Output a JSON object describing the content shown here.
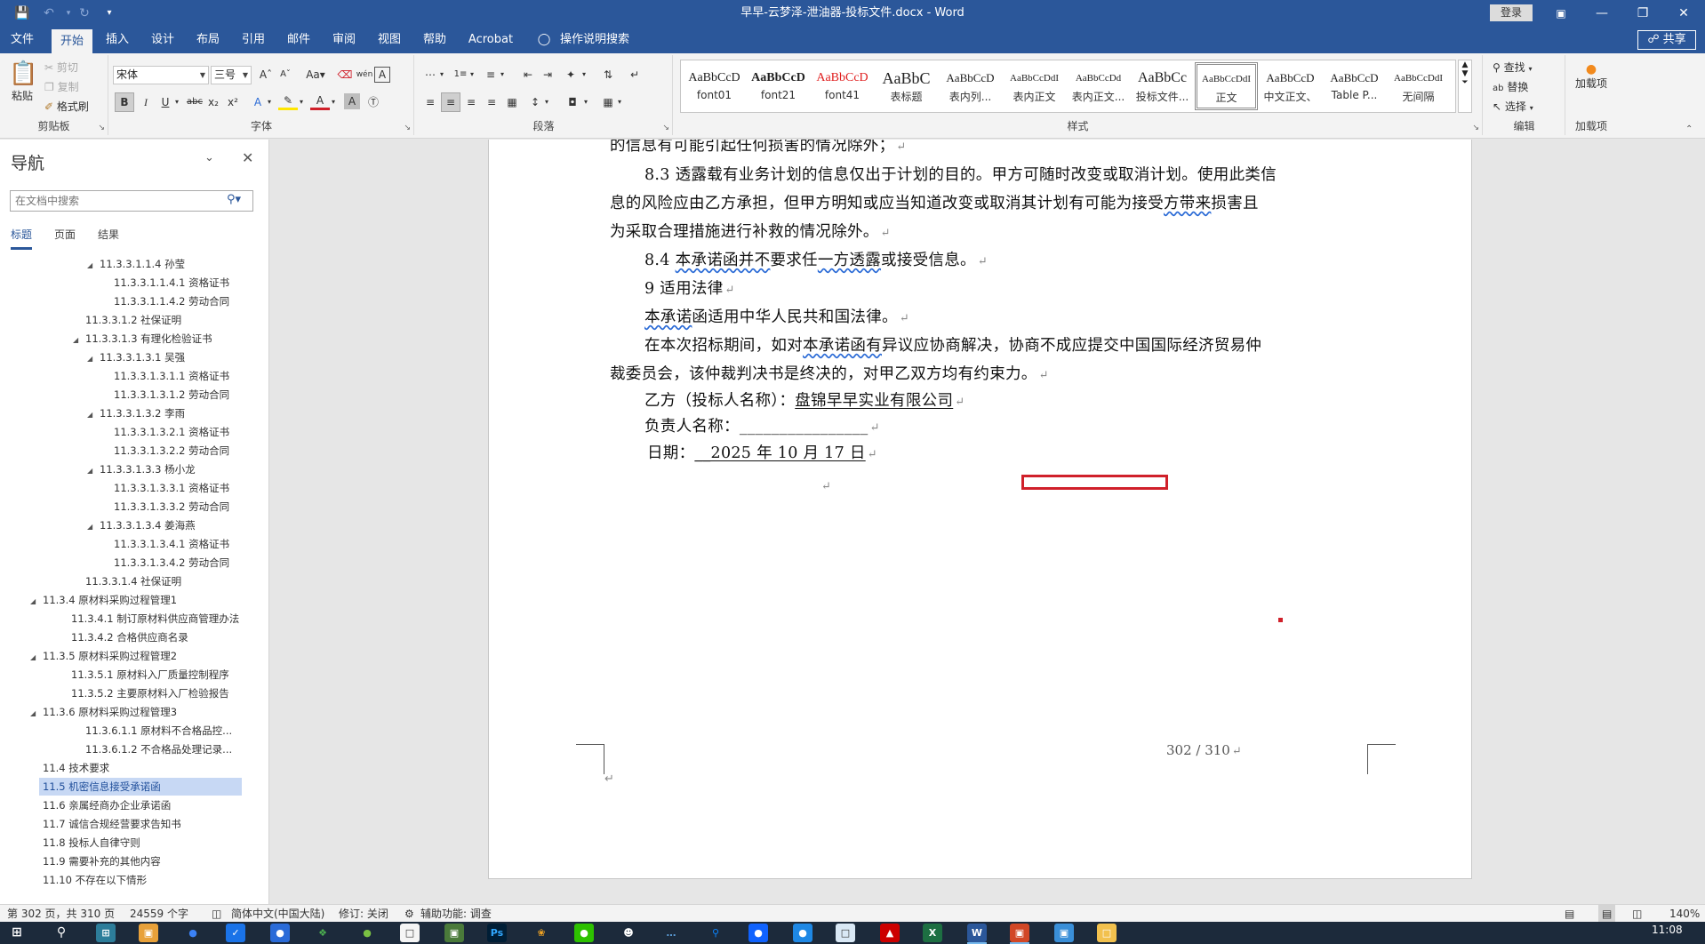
{
  "window": {
    "title": "早早-云梦泽-泄油器-投标文件.docx  -  Word",
    "login_label": "登录",
    "share_label": "共享"
  },
  "tabs": [
    "文件",
    "开始",
    "插入",
    "设计",
    "布局",
    "引用",
    "邮件",
    "审阅",
    "视图",
    "帮助",
    "Acrobat"
  ],
  "tell_me": "操作说明搜索",
  "ribbon": {
    "clipboard": {
      "label": "剪贴板",
      "paste": "粘贴",
      "cut": "剪切",
      "copy": "复制",
      "format_painter": "格式刷"
    },
    "font": {
      "label": "字体",
      "font_name": "宋体",
      "font_size": "三号"
    },
    "paragraph": {
      "label": "段落"
    },
    "styles": {
      "label": "样式",
      "items": [
        {
          "sample": "AaBbCcD",
          "name": "font01"
        },
        {
          "sample": "AaBbCcD",
          "name": "font21"
        },
        {
          "sample": "AaBbCcD",
          "name": "font41"
        },
        {
          "sample": "AaBbC",
          "name": "表标题"
        },
        {
          "sample": "AaBbCcD",
          "name": "表内列..."
        },
        {
          "sample": "AaBbCcDdI",
          "name": "表内正文"
        },
        {
          "sample": "AaBbCcDd",
          "name": "表内正文..."
        },
        {
          "sample": "AaBbCc",
          "name": "投标文件..."
        },
        {
          "sample": "AaBbCcDdI",
          "name": "正文"
        },
        {
          "sample": "AaBbCcD",
          "name": "中文正文、"
        },
        {
          "sample": "AaBbCcD",
          "name": "Table P..."
        },
        {
          "sample": "AaBbCcDdI",
          "name": "无间隔"
        }
      ]
    },
    "editing": {
      "label": "编辑",
      "find": "查找",
      "replace": "替换",
      "select": "选择"
    },
    "addins": {
      "label": "加载项",
      "button": "加载项"
    }
  },
  "nav": {
    "title": "导航",
    "search_placeholder": "在文档中搜索",
    "tabs": [
      "标题",
      "页面",
      "结果"
    ],
    "items": [
      {
        "text": "11.3.3.1.1.4 孙莹",
        "level": 4,
        "expanded": true
      },
      {
        "text": "11.3.3.1.1.4.1 资格证书",
        "level": 5
      },
      {
        "text": "11.3.3.1.1.4.2 劳动合同",
        "level": 5
      },
      {
        "text": "11.3.3.1.2 社保证明",
        "level": 3
      },
      {
        "text": "11.3.3.1.3 有理化检验证书",
        "level": 3,
        "expanded": true
      },
      {
        "text": "11.3.3.1.3.1 吴强",
        "level": 4,
        "expanded": true
      },
      {
        "text": "11.3.3.1.3.1.1 资格证书",
        "level": 5
      },
      {
        "text": "11.3.3.1.3.1.2 劳动合同",
        "level": 5
      },
      {
        "text": "11.3.3.1.3.2 李雨",
        "level": 4,
        "expanded": true
      },
      {
        "text": "11.3.3.1.3.2.1 资格证书",
        "level": 5
      },
      {
        "text": "11.3.3.1.3.2.2 劳动合同",
        "level": 5
      },
      {
        "text": "11.3.3.1.3.3 杨小龙",
        "level": 4,
        "expanded": true
      },
      {
        "text": "11.3.3.1.3.3.1 资格证书",
        "level": 5
      },
      {
        "text": "11.3.3.1.3.3.2 劳动合同",
        "level": 5
      },
      {
        "text": "11.3.3.1.3.4 姜海燕",
        "level": 4,
        "expanded": true
      },
      {
        "text": "11.3.3.1.3.4.1 资格证书",
        "level": 5
      },
      {
        "text": "11.3.3.1.3.4.2 劳动合同",
        "level": 5
      },
      {
        "text": "11.3.3.1.4 社保证明",
        "level": 3
      },
      {
        "text": "11.3.4 原材料采购过程管理1",
        "level": 1,
        "expanded": true
      },
      {
        "text": "11.3.4.1 制订原材料供应商管理办法",
        "level": 2
      },
      {
        "text": "11.3.4.2 合格供应商名录",
        "level": 2
      },
      {
        "text": "11.3.5 原材料采购过程管理2",
        "level": 1,
        "expanded": true
      },
      {
        "text": "11.3.5.1 原材料入厂质量控制程序",
        "level": 2
      },
      {
        "text": "11.3.5.2 主要原材料入厂检验报告",
        "level": 2
      },
      {
        "text": "11.3.6 原材料采购过程管理3",
        "level": 1,
        "expanded": true
      },
      {
        "text": "11.3.6.1.1 原材料不合格品控...",
        "level": 3
      },
      {
        "text": "11.3.6.1.2 不合格品处理记录...",
        "level": 3
      },
      {
        "text": "11.4 技术要求",
        "level": 0
      },
      {
        "text": "11.5 机密信息接受承诺函",
        "level": 0,
        "selected": true
      },
      {
        "text": "11.6 亲属经商办企业承诺函",
        "level": 0
      },
      {
        "text": "11.7 诚信合规经营要求告知书",
        "level": 0
      },
      {
        "text": "11.8 投标人自律守则",
        "level": 0
      },
      {
        "text": "11.9 需要补充的其他内容",
        "level": 0
      },
      {
        "text": "11.10 不存在以下情形",
        "level": 0
      }
    ]
  },
  "document": {
    "p1": "的信息有可能引起任何损害的情况除外；",
    "p2a": "8.3 透露载有业务计划的信息仅出于计划的目的。甲方可随时改变或取消计划。使用此类信",
    "p2b_pre": "息的风险应由乙方承担，但甲方明知或应当知道改变或取消其计划有可能为接受",
    "p2b_wavy": "方带来",
    "p2b_post": "损害且",
    "p2c": "为采取合理措施进行补救的情况除外。",
    "p3_pre": "8.4 ",
    "p3_wavy1": "本承诺函并不",
    "p3_mid": "要求任",
    "p3_wavy2": "一方透露",
    "p3_post": "或接受信息。",
    "p4": "9 适用法律",
    "p5_wavy": "本承诺",
    "p5_post": "函适用中华人民共和国法律。",
    "p6a_pre": "在本次招标期间，如对",
    "p6a_wavy": "本承诺函有",
    "p6a_post": "异议应协商解决，协商不成应提交中国国际经济贸易仲",
    "p6b": "裁委员会，该仲裁判决书是终决的，对甲乙双方均有约束力。",
    "p7_label": "乙方（投标人名称）：",
    "p7_value": "盘锦早早实业有限公司",
    "p8_label": "负责人名称：",
    "p8_value": "________________",
    "p9_label": "日期：",
    "p9_value": "__2025 年 10 月 17 日",
    "page_number": "302  /  310"
  },
  "status": {
    "page": "第 302 页，共 310 页",
    "words": "24559 个字",
    "language": "简体中文(中国大陆)",
    "track": "修订: 关闭",
    "accessibility": "辅助功能: 调查",
    "zoom": "140%"
  },
  "taskbar": {
    "time": "11:08"
  }
}
